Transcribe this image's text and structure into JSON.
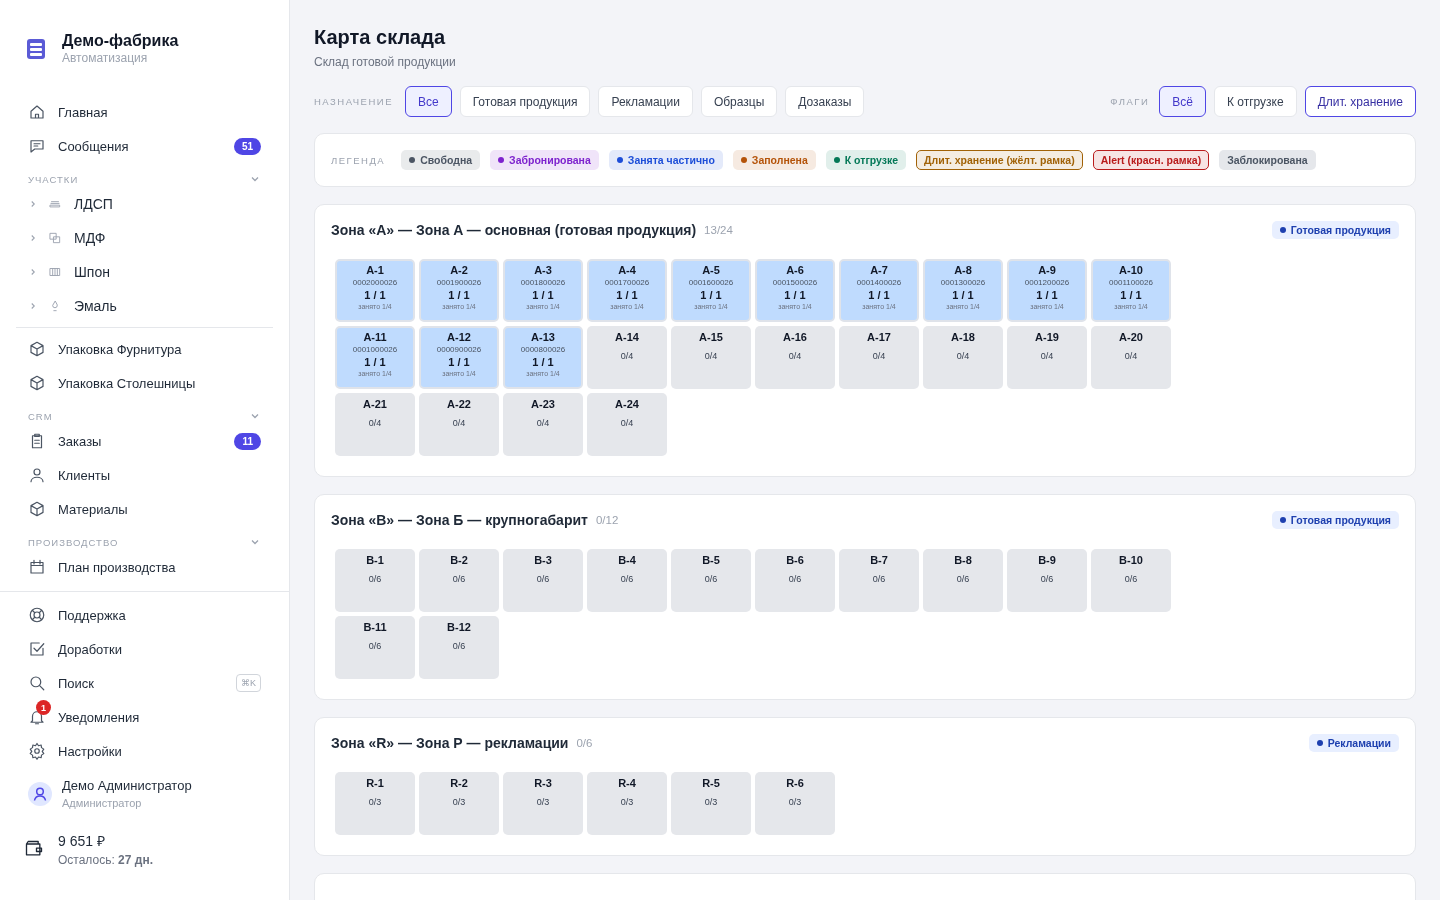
{
  "brand": {
    "name": "Демо-фабрика",
    "subtitle": "Автоматизация"
  },
  "sidebar": {
    "sections": [
      {
        "items": [
          {
            "label": "Главная"
          },
          {
            "label": "Сообщения",
            "badge": "51"
          }
        ]
      },
      {
        "title": "УЧАСТКИ",
        "expanded": true,
        "items": [
          {
            "label": "ЛДСП",
            "expanded": false
          },
          {
            "label": "МДФ",
            "expanded": false
          },
          {
            "label": "Шпон",
            "expanded": false
          },
          {
            "label": "Эмаль",
            "expanded": false
          }
        ]
      },
      {
        "divider": true,
        "items": [
          {
            "label": "Упаковка Фурнитура"
          },
          {
            "label": "Упаковка Столешницы"
          }
        ]
      },
      {
        "title": "CRM",
        "expanded": true,
        "items": [
          {
            "label": "Заказы",
            "badge": "11"
          },
          {
            "label": "Клиенты"
          },
          {
            "label": "Материалы"
          }
        ]
      },
      {
        "title": "ПРОИЗВОДСТВО",
        "expanded": true,
        "items": [
          {
            "label": "План производства"
          }
        ]
      }
    ],
    "footer": [
      {
        "label": "Поддержка"
      },
      {
        "label": "Доработки"
      },
      {
        "label": "Поиск",
        "shortcut": "⌘K"
      },
      {
        "label": "Уведомления",
        "notification": "1"
      },
      {
        "label": "Настройки"
      }
    ],
    "user": {
      "name": "Демо Администратор",
      "role": "Администратор"
    },
    "balance": {
      "amount": "9 651 ₽",
      "remaining": "Осталось: **27 дн.**"
    }
  },
  "page": {
    "title": "Карта склада",
    "subtitle": "Склад готовой продукции"
  },
  "filters": {
    "purpose": {
      "label": "НАЗНАЧЕНИЕ",
      "options": [
        {
          "label": "Все",
          "selected": true
        },
        {
          "label": "Готовая продукция",
          "selected": false
        },
        {
          "label": "Рекламации",
          "selected": false
        },
        {
          "label": "Образцы",
          "selected": false
        },
        {
          "label": "Дозаказы",
          "selected": false
        }
      ]
    },
    "flags": {
      "label": "ФЛАГИ",
      "options": [
        {
          "label": "Всё",
          "selected": true,
          "emphasized": false
        },
        {
          "label": "К отгрузке",
          "selected": false,
          "emphasized": false
        },
        {
          "label": "Длит. хранение",
          "selected": false,
          "emphasized": true
        }
      ]
    }
  },
  "legend": {
    "label": "ЛЕГЕНДА",
    "items": [
      {
        "label": "Свободна",
        "kind": "dot",
        "color": "#4b5563"
      },
      {
        "label": "Забронирована",
        "kind": "dot",
        "color": "#7e22ce"
      },
      {
        "label": "Занята частично",
        "kind": "dot",
        "color": "#1d4ed8"
      },
      {
        "label": "Заполнена",
        "kind": "dot",
        "color": "#b45309"
      },
      {
        "label": "К отгрузке",
        "kind": "dot",
        "color": "#047857"
      },
      {
        "label": "Длит. хранение (жёлт. рамка)",
        "kind": "outlined",
        "color": "#a16207"
      },
      {
        "label": "Alert (красн. рамка)",
        "kind": "outlined",
        "color": "#b91c1c"
      },
      {
        "label": "Заблокирована",
        "kind": "plain",
        "color": "#4b5563"
      }
    ]
  },
  "zones": [
    {
      "title": "Зона «A» — Зона A — основная (готовая продукция)",
      "count": "13/24",
      "tag": "Готовая продукция",
      "cells": [
        {
          "kind": "partial",
          "name": "A-1",
          "code": "0002000026",
          "fill": "1 / 1",
          "note": "занято 1/4"
        },
        {
          "kind": "partial",
          "name": "A-2",
          "code": "0001900026",
          "fill": "1 / 1",
          "note": "занято 1/4"
        },
        {
          "kind": "partial",
          "name": "A-3",
          "code": "0001800026",
          "fill": "1 / 1",
          "note": "занято 1/4"
        },
        {
          "kind": "partial",
          "name": "A-4",
          "code": "0001700026",
          "fill": "1 / 1",
          "note": "занято 1/4"
        },
        {
          "kind": "partial",
          "name": "A-5",
          "code": "0001600026",
          "fill": "1 / 1",
          "note": "занято 1/4"
        },
        {
          "kind": "partial",
          "name": "A-6",
          "code": "0001500026",
          "fill": "1 / 1",
          "note": "занято 1/4"
        },
        {
          "kind": "partial",
          "name": "A-7",
          "code": "0001400026",
          "fill": "1 / 1",
          "note": "занято 1/4"
        },
        {
          "kind": "partial",
          "name": "A-8",
          "code": "0001300026",
          "fill": "1 / 1",
          "note": "занято 1/4"
        },
        {
          "kind": "partial",
          "name": "A-9",
          "code": "0001200026",
          "fill": "1 / 1",
          "note": "занято 1/4"
        },
        {
          "kind": "partial",
          "name": "A-10",
          "code": "0001100026",
          "fill": "1 / 1",
          "note": "занято 1/4"
        },
        {
          "kind": "partial",
          "name": "A-11",
          "code": "0001000026",
          "fill": "1 / 1",
          "note": "занято 1/4"
        },
        {
          "kind": "partial",
          "name": "A-12",
          "code": "0000900026",
          "fill": "1 / 1",
          "note": "занято 1/4"
        },
        {
          "kind": "partial",
          "name": "A-13",
          "code": "0000800026",
          "fill": "1 / 1",
          "note": "занято 1/4"
        },
        {
          "kind": "free",
          "name": "A-14",
          "fill": "0/4"
        },
        {
          "kind": "free",
          "name": "A-15",
          "fill": "0/4"
        },
        {
          "kind": "free",
          "name": "A-16",
          "fill": "0/4"
        },
        {
          "kind": "free",
          "name": "A-17",
          "fill": "0/4"
        },
        {
          "kind": "free",
          "name": "A-18",
          "fill": "0/4"
        },
        {
          "kind": "free",
          "name": "A-19",
          "fill": "0/4"
        },
        {
          "kind": "free",
          "name": "A-20",
          "fill": "0/4"
        },
        {
          "kind": "free",
          "name": "A-21",
          "fill": "0/4"
        },
        {
          "kind": "free",
          "name": "A-22",
          "fill": "0/4"
        },
        {
          "kind": "free",
          "name": "A-23",
          "fill": "0/4"
        },
        {
          "kind": "free",
          "name": "A-24",
          "fill": "0/4"
        }
      ]
    },
    {
      "title": "Зона «B» — Зона Б — крупногабарит",
      "count": "0/12",
      "tag": "Готовая продукция",
      "cells": [
        {
          "kind": "free",
          "name": "B-1",
          "fill": "0/6"
        },
        {
          "kind": "free",
          "name": "B-2",
          "fill": "0/6"
        },
        {
          "kind": "free",
          "name": "B-3",
          "fill": "0/6"
        },
        {
          "kind": "free",
          "name": "B-4",
          "fill": "0/6"
        },
        {
          "kind": "free",
          "name": "B-5",
          "fill": "0/6"
        },
        {
          "kind": "free",
          "name": "B-6",
          "fill": "0/6"
        },
        {
          "kind": "free",
          "name": "B-7",
          "fill": "0/6"
        },
        {
          "kind": "free",
          "name": "B-8",
          "fill": "0/6"
        },
        {
          "kind": "free",
          "name": "B-9",
          "fill": "0/6"
        },
        {
          "kind": "free",
          "name": "B-10",
          "fill": "0/6"
        },
        {
          "kind": "free",
          "name": "B-11",
          "fill": "0/6"
        },
        {
          "kind": "free",
          "name": "B-12",
          "fill": "0/6"
        }
      ]
    },
    {
      "title": "Зона «R» — Зона Р — рекламации",
      "count": "0/6",
      "tag": "Рекламации",
      "cells": [
        {
          "kind": "free",
          "name": "R-1",
          "fill": "0/3"
        },
        {
          "kind": "free",
          "name": "R-2",
          "fill": "0/3"
        },
        {
          "kind": "free",
          "name": "R-3",
          "fill": "0/3"
        },
        {
          "kind": "free",
          "name": "R-4",
          "fill": "0/3"
        },
        {
          "kind": "free",
          "name": "R-5",
          "fill": "0/3"
        },
        {
          "kind": "free",
          "name": "R-6",
          "fill": "0/3"
        }
      ]
    }
  ]
}
